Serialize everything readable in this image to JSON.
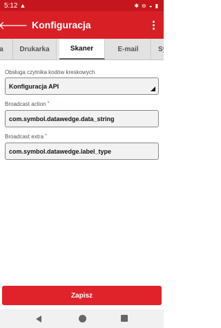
{
  "status_bar": {
    "time": "5:12",
    "icons": [
      "alert-icon",
      "bluetooth-icon",
      "do-not-disturb-icon",
      "wifi-icon",
      "battery-icon"
    ]
  },
  "app_bar": {
    "title": "Konfiguracja",
    "back_icon": "arrow-left-icon",
    "menu_icon": "more-vert-icon"
  },
  "tabs": [
    {
      "label": "a",
      "active": false
    },
    {
      "label": "Drukarka",
      "active": false
    },
    {
      "label": "Skaner",
      "active": true
    },
    {
      "label": "E-mail",
      "active": false
    },
    {
      "label": "Sy",
      "active": false
    }
  ],
  "form": {
    "scanner_label": "Obsługa czytnika kodów kreskowych",
    "scanner_value": "Konfiguracja API",
    "broadcast_action_label": "Broadcast action",
    "broadcast_action_required": "*",
    "broadcast_action_value": "com.symbol.datawedge.data_string",
    "broadcast_extra_label": "Broadcast extra",
    "broadcast_extra_required": "*",
    "broadcast_extra_value": "com.symbol.datawedge.label_type"
  },
  "save_button": {
    "label": "Zapisz"
  },
  "colors": {
    "primary": "#d91f26",
    "status_bar": "#c4161c",
    "button": "#e0232b"
  }
}
